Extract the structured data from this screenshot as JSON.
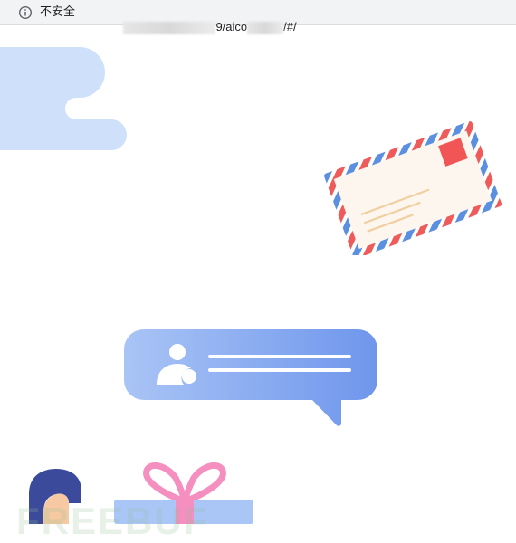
{
  "browser": {
    "security_label": "不安全",
    "url_mid": "9/aico",
    "url_end": "/#/",
    "icon": "info-icon"
  },
  "page": {
    "watermark_text": "FREEBUF",
    "colors": {
      "cloud": "#cfe0fa",
      "envelope_paper": "#fdf6ee",
      "stamp": "#f25555",
      "airmail_red": "#ef5a5a",
      "airmail_blue": "#5b8fe0",
      "bubble_start": "#a9c4f5",
      "bubble_end": "#6f96ec",
      "gift_ribbon": "#f48fc0",
      "gift_box": "#a9c6f7"
    },
    "icons": [
      "cloud-decoration",
      "envelope-icon",
      "chat-bubble-icon",
      "user-icon",
      "avatar-icon",
      "gift-icon"
    ]
  }
}
